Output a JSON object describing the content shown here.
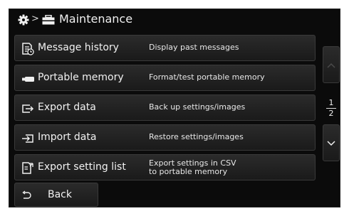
{
  "header": {
    "separator": ">",
    "title": "Maintenance"
  },
  "menu": {
    "items": [
      {
        "label": "Message history",
        "desc": "Display past messages",
        "icon": "message-history-icon"
      },
      {
        "label": "Portable memory",
        "desc": "Format/test portable memory",
        "icon": "portable-memory-icon"
      },
      {
        "label": "Export data",
        "desc": "Back up settings/images",
        "icon": "export-icon"
      },
      {
        "label": "Import data",
        "desc": "Restore settings/images",
        "icon": "import-icon"
      },
      {
        "label": "Export setting list",
        "desc_line1": "Export settings in CSV",
        "desc_line2": "to portable memory",
        "icon": "export-setting-list-icon"
      }
    ]
  },
  "pager": {
    "current": "1",
    "total": "2"
  },
  "footer": {
    "back_label": "Back"
  }
}
